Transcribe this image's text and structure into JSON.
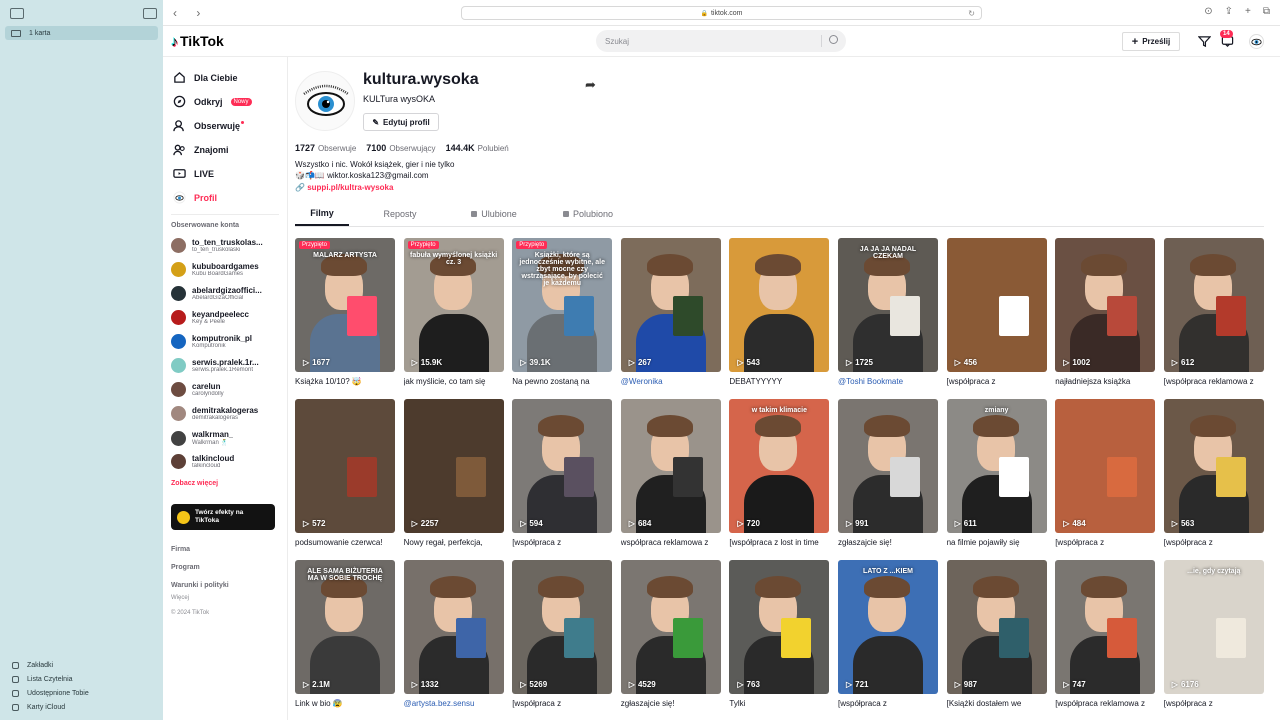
{
  "browser": {
    "url": "tiktok.com",
    "tab_label": "1 karta",
    "sidebar_bottom": [
      "Zakładki",
      "Lista Czytelnia",
      "Udostępnione Tobie",
      "Karty iCloud"
    ]
  },
  "header": {
    "logo": "TikTok",
    "search_placeholder": "Szukaj",
    "upload_label": "Prześlij",
    "inbox_badge": "14"
  },
  "nav": {
    "items": [
      {
        "label": "Dla Ciebie"
      },
      {
        "label": "Odkryj",
        "badge": "Nowy"
      },
      {
        "label": "Obserwuję"
      },
      {
        "label": "Znajomi"
      },
      {
        "label": "LIVE"
      },
      {
        "label": "Profil"
      }
    ],
    "followed_title": "Obserwowane konta",
    "accounts": [
      {
        "name": "to_ten_truskolas...",
        "sub": "to_ten_truskolaski",
        "color": "#8d6e63"
      },
      {
        "name": "kububoardgames",
        "sub": "Kubu BoardGames",
        "color": "#d4a017"
      },
      {
        "name": "abelardgizaoffici...",
        "sub": "AbelardGizaOfficial",
        "color": "#263238"
      },
      {
        "name": "keyandpeelecc",
        "sub": "Key & Peele",
        "color": "#b71c1c"
      },
      {
        "name": "komputronik_pl",
        "sub": "Komputronik",
        "color": "#1565c0"
      },
      {
        "name": "serwis.pralek.1r...",
        "sub": "serwis.pralek.1Remont",
        "color": "#80cbc4"
      },
      {
        "name": "carelun",
        "sub": "carolyndolly",
        "color": "#6d4c41"
      },
      {
        "name": "demitrakalogeras",
        "sub": "demitrakalogeras",
        "color": "#a1887f"
      },
      {
        "name": "walkrman_",
        "sub": "Walkrman 🕺",
        "color": "#424242"
      },
      {
        "name": "talkincloud",
        "sub": "talkincloud",
        "color": "#5d4037"
      }
    ],
    "see_more": "Zobacz więcej",
    "effects": "Twórz efekty na TikToka",
    "footer_links": [
      "Firma",
      "Program",
      "Warunki i polityki"
    ],
    "more": "Więcej",
    "copyright": "© 2024 TikTok"
  },
  "profile": {
    "username": "kultura.wysoka",
    "nickname": "KULTura wysOKA",
    "edit_label": "Edytuj profil",
    "following_count": "1727",
    "following_label": "Obserwuje",
    "followers_count": "7100",
    "followers_label": "Obserwujący",
    "likes_count": "144.4K",
    "likes_label": "Polubień",
    "bio_line1": "Wszystko i nic. Wokół książek, gier i nie tylko",
    "bio_line2": "🎲📬📖 wiktor.koska123@gmail.com",
    "link": "suppi.pl/kultra-wysoka",
    "tabs": [
      "Filmy",
      "Reposty",
      "Ulubione",
      "Polubiono"
    ]
  },
  "videos": [
    {
      "views": "1677",
      "caption": "Książka 10/10? 🤯",
      "pinned": "Przypięto",
      "overlay": "MALARZ ARTYSTA",
      "bg": "#6d6a66",
      "shirt": "#5a7391",
      "book": "#ff4d6d"
    },
    {
      "views": "15.9K",
      "caption": "jak myślicie, co tam się",
      "pinned": "Przypięto",
      "overlay": "fabuła wymyślonej książki cz. 3",
      "bg": "#a39c92",
      "shirt": "#1e1e1e",
      "book": ""
    },
    {
      "views": "39.1K",
      "caption": "Na pewno zostaną na",
      "pinned": "Przypięto",
      "overlay": "Książki, które są jednocześnie wybitne, ale zbyt mocne czy wstrząsające, by polecić je każdemu",
      "bg": "#8f9aa4",
      "shirt": "#6a6f73",
      "book": "#3e7cb1"
    },
    {
      "views": "267",
      "caption": "@Weronika",
      "link": true,
      "bg": "#7d6c5b",
      "shirt": "#1f4aa8",
      "book": "#2e4a2a"
    },
    {
      "views": "543",
      "caption": "DEBATYYYYY",
      "bg": "#d89a3a",
      "shirt": "#2b2b2b",
      "book": ""
    },
    {
      "views": "1725",
      "caption": "@Toshi Bookmate",
      "link": true,
      "overlay": "JA JA JA NADAL CZEKAM",
      "bg": "#5e5a54",
      "shirt": "#2f2f2f",
      "book": "#e9e6df"
    },
    {
      "views": "456",
      "caption": "[współpraca z",
      "bg": "#8a5a36",
      "shirt": "",
      "book": "#ffffff"
    },
    {
      "views": "1002",
      "caption": "najładniejsza książka",
      "bg": "#6a5043",
      "shirt": "#3a2a26",
      "book": "#b8493a"
    },
    {
      "views": "612",
      "caption": "[współpraca reklamowa z",
      "bg": "#6e5f53",
      "shirt": "#32302e",
      "book": "#b33a2b"
    },
    {
      "views": "572",
      "caption": "podsumowanie czerwca!",
      "bg": "#5d4a3b",
      "shirt": "",
      "book": "#9b3b2b"
    },
    {
      "views": "2257",
      "caption": "Nowy regał, perfekcja,",
      "bg": "#4d3b2d",
      "shirt": "",
      "book": "#7e5a3a"
    },
    {
      "views": "594",
      "caption": "[współpraca z",
      "bg": "#7d7a77",
      "shirt": "#2f2f33",
      "book": "#5a5060"
    },
    {
      "views": "684",
      "caption": "współpraca reklamowa z",
      "bg": "#9a938b",
      "shirt": "#202020",
      "book": "#333"
    },
    {
      "views": "720",
      "caption": "[współpraca z lost in time",
      "overlay": "w takim klimacie",
      "bg": "#d5654b",
      "shirt": "#1a1a1a",
      "book": ""
    },
    {
      "views": "991",
      "caption": "zgłaszajcie się!",
      "bg": "#7a7570",
      "shirt": "#2c2c2c",
      "book": "#d8d8d8"
    },
    {
      "views": "611",
      "caption": "na filmie pojawiły się",
      "overlay": "zmiany",
      "bg": "#8c8a86",
      "shirt": "#1f1f1f",
      "book": "#ffffff"
    },
    {
      "views": "484",
      "caption": "[współpraca z",
      "bg": "#b8603e",
      "shirt": "",
      "book": "#d86a3f"
    },
    {
      "views": "563",
      "caption": "[współpraca z",
      "bg": "#6b5848",
      "shirt": "#2a2a2a",
      "book": "#e6c04a"
    },
    {
      "views": "2.1M",
      "caption": "Link w bio 😰",
      "overlay": "ALE SAMA BIŻUTERIA MA W SOBIE TROCHĘ",
      "bg": "#6e6a66",
      "shirt": "#3a3a3a",
      "book": ""
    },
    {
      "views": "1332",
      "caption": "@artysta.bez.sensu",
      "link": true,
      "bg": "#77706a",
      "shirt": "#2b2b2b",
      "book": "#3e65a8"
    },
    {
      "views": "5269",
      "caption": "[współpraca z",
      "bg": "#6c6760",
      "shirt": "#2a2a2a",
      "book": "#3f7c8c"
    },
    {
      "views": "4529",
      "caption": "zgłaszajcie się!",
      "bg": "#7b7671",
      "shirt": "#2a2a2a",
      "book": "#3a9a3a"
    },
    {
      "views": "763",
      "caption": "Tylki",
      "bg": "#5b5b58",
      "shirt": "#2a2a2a",
      "book": "#f2d22e"
    },
    {
      "views": "721",
      "caption": "[współpraca z",
      "overlay": "LATO Z ...KIEM",
      "bg": "#3d6fb5",
      "shirt": "#2a2a2a",
      "book": ""
    },
    {
      "views": "987",
      "caption": "[Książki dostałem we",
      "bg": "#6d645b",
      "shirt": "#2a2a2a",
      "book": "#2f5f6a"
    },
    {
      "views": "747",
      "caption": "[współpraca reklamowa z",
      "bg": "#7a7671",
      "shirt": "#2b2b2b",
      "book": "#d65a3a"
    },
    {
      "views": "6176",
      "caption": "[współpraca z",
      "overlay": "...ie, gdy czytają",
      "bg": "#d9d4cb",
      "shirt": "",
      "book": "#efe9dd"
    }
  ]
}
